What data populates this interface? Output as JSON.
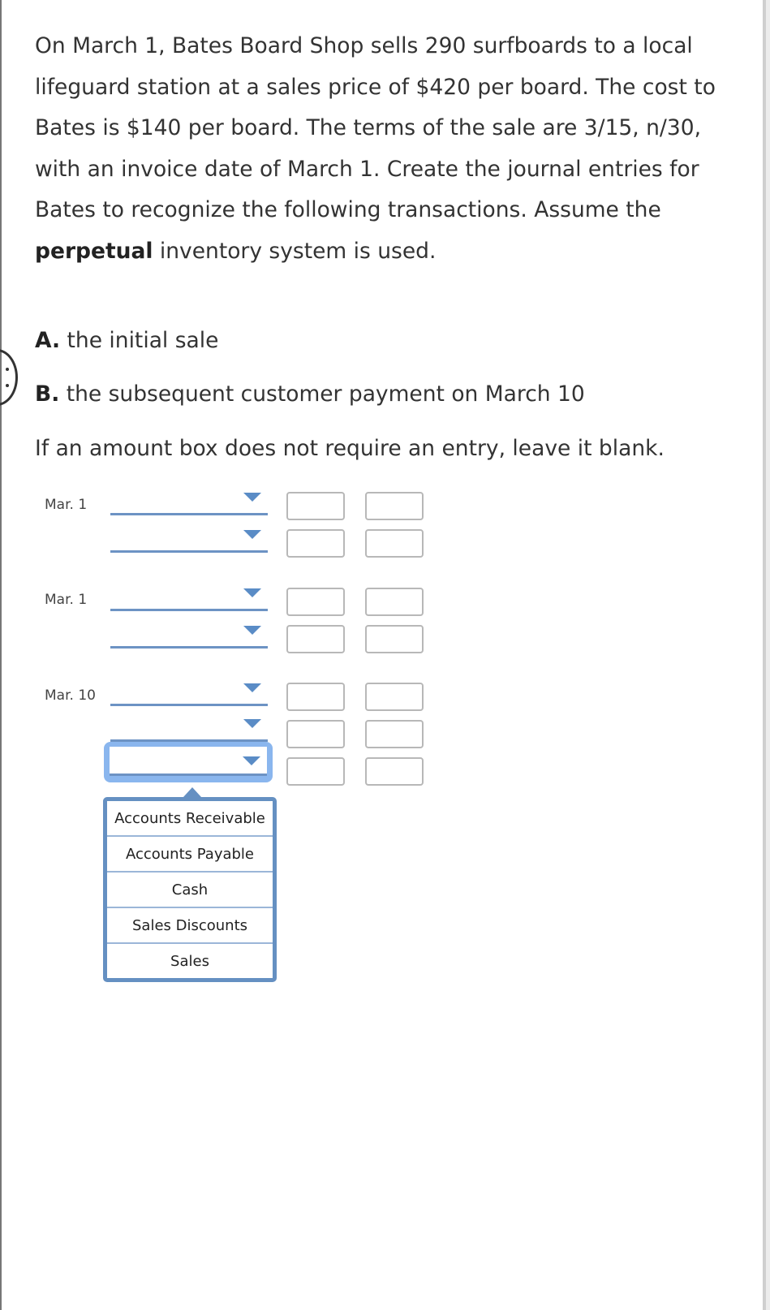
{
  "problem": {
    "text_before_bold": "On March 1, Bates Board Shop sells 290 surfboards to a local lifeguard station at a sales price of $420 per board. The cost to Bates is $140 per board. The terms of the sale are 3/15, n/30, with an invoice date of March 1. Create the journal entries for Bates to recognize the following transactions. Assume the ",
    "bold_word": "perpetual",
    "text_after_bold": " inventory system is used."
  },
  "parts": [
    {
      "letter": "A.",
      "text": " the initial sale"
    },
    {
      "letter": "B.",
      "text": " the subsequent customer payment on March 10"
    }
  ],
  "instruction": "If an amount box does not require an entry, leave it blank.",
  "journal": {
    "entries": [
      {
        "date": "Mar. 1",
        "rows": [
          {
            "account": "",
            "debit": "",
            "credit": ""
          },
          {
            "account": "",
            "debit": "",
            "credit": ""
          }
        ]
      },
      {
        "date": "Mar. 1",
        "rows": [
          {
            "account": "",
            "debit": "",
            "credit": ""
          },
          {
            "account": "",
            "debit": "",
            "credit": ""
          }
        ]
      },
      {
        "date": "Mar. 10",
        "rows": [
          {
            "account": "",
            "debit": "",
            "credit": ""
          },
          {
            "account": "",
            "debit": "",
            "credit": ""
          },
          {
            "account": "",
            "debit": "",
            "credit": ""
          }
        ]
      }
    ]
  },
  "dropdown": {
    "open": true,
    "options": [
      "Accounts Receivable",
      "Accounts Payable",
      "Cash",
      "Sales Discounts",
      "Sales"
    ]
  },
  "colors": {
    "accent": "#5a8cc6",
    "focus_ring": "#8ab6ee",
    "menu_border": "#6590c2"
  }
}
